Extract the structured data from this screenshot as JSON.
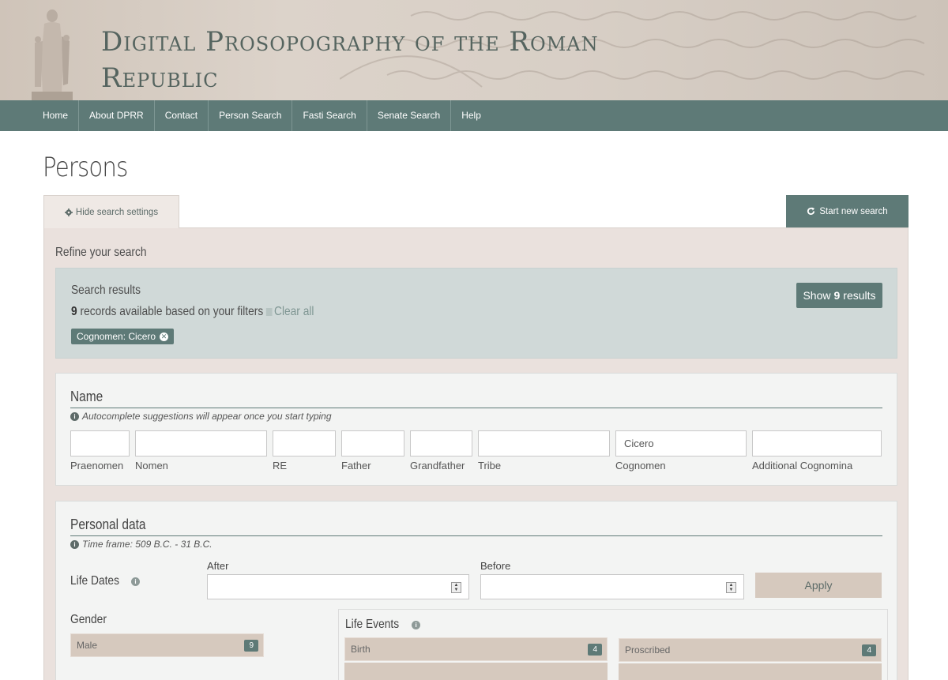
{
  "site": {
    "title": "Digital Prosopography of the Roman Republic"
  },
  "nav": {
    "items": [
      {
        "label": "Home"
      },
      {
        "label": "About DPRR"
      },
      {
        "label": "Contact"
      },
      {
        "label": "Person Search"
      },
      {
        "label": "Fasti Search"
      },
      {
        "label": "Senate Search"
      },
      {
        "label": "Help"
      }
    ]
  },
  "page": {
    "title": "Persons"
  },
  "tabs": {
    "hide_label": "Hide search settings",
    "new_search_label": "Start new search"
  },
  "refine": {
    "title": "Refine your search"
  },
  "results": {
    "title": "Search results",
    "count": "9",
    "count_suffix": "records available based on your filters",
    "clear_all": "Clear all",
    "show_prefix": "Show",
    "show_count": "9",
    "show_suffix": "results",
    "active_filter": "Cognomen: Cicero"
  },
  "name_section": {
    "title": "Name",
    "hint": "Autocomplete suggestions will appear once you start typing",
    "fields": {
      "praenomen": {
        "label": "Praenomen",
        "value": ""
      },
      "nomen": {
        "label": "Nomen",
        "value": ""
      },
      "re": {
        "label": "RE",
        "value": ""
      },
      "father": {
        "label": "Father",
        "value": ""
      },
      "grandfather": {
        "label": "Grandfather",
        "value": ""
      },
      "tribe": {
        "label": "Tribe",
        "value": ""
      },
      "cognomen": {
        "label": "Cognomen",
        "value": "Cicero"
      },
      "additional_cognomina": {
        "label": "Additional Cognomina",
        "value": ""
      }
    }
  },
  "personal_section": {
    "title": "Personal data",
    "hint": "Time frame: 509 B.C. - 31 B.C.",
    "life_dates_label": "Life Dates",
    "after_label": "After",
    "before_label": "Before",
    "apply_label": "Apply",
    "gender_title": "Gender",
    "gender_items": [
      {
        "label": "Male",
        "count": "9"
      }
    ],
    "life_events_title": "Life Events",
    "life_events": [
      {
        "label": "Birth",
        "count": "4"
      },
      {
        "label": "Proscribed",
        "count": "4"
      }
    ]
  },
  "colors": {
    "accent": "#5e7a77",
    "panel": "#eae1dd",
    "facet": "#d6c9be",
    "results_bg": "#d0d9d8"
  }
}
